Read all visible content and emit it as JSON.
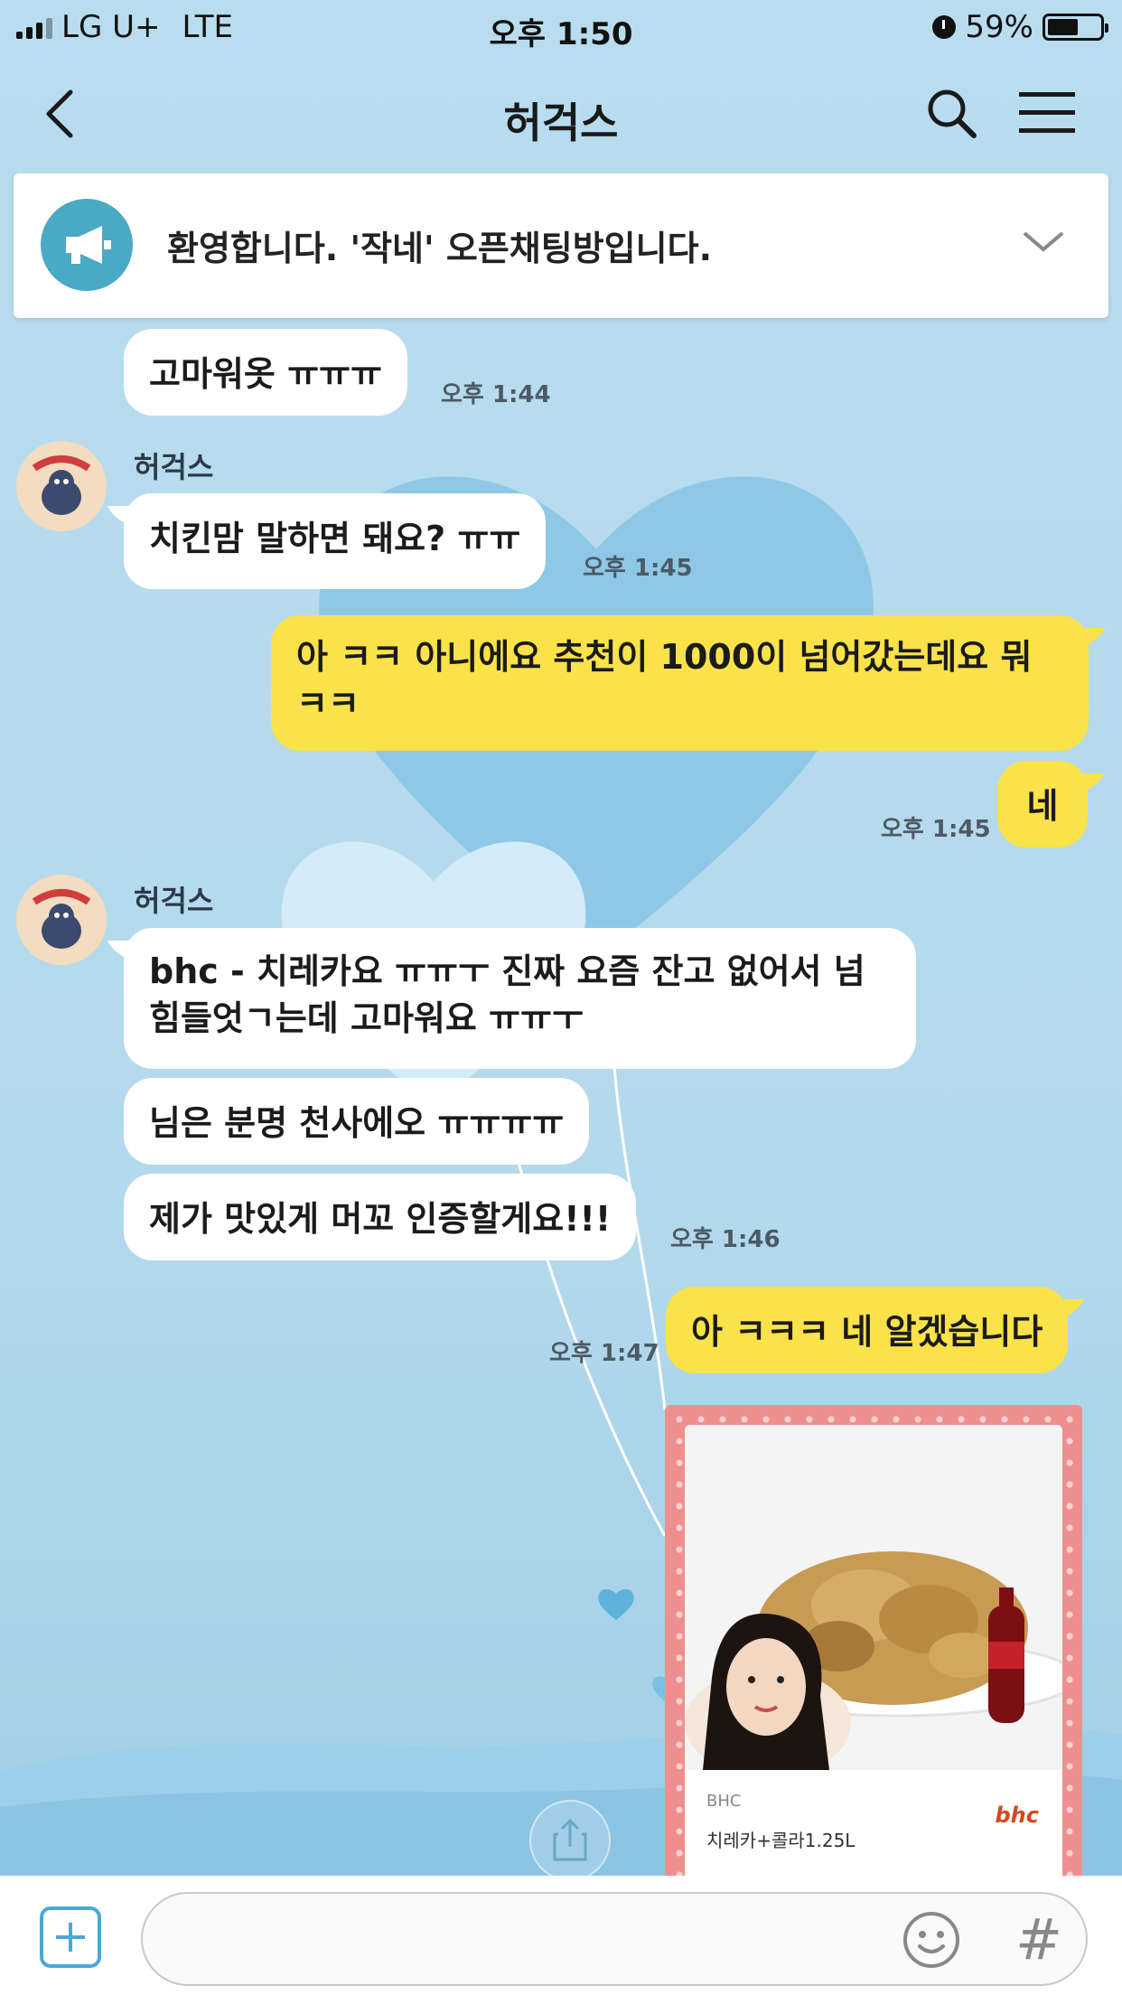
{
  "status_bar": {
    "carrier": "LG U+",
    "network": "LTE",
    "time": "오후 1:50",
    "battery": "59%",
    "battery_level": 0.59
  },
  "header": {
    "title": "허걱스"
  },
  "notice": {
    "text": "환영합니다. '작네' 오픈채팅방입니다."
  },
  "messages": [
    {
      "id": "m1",
      "direction": "in",
      "text": "고마워옷 ㅠㅠㅠ",
      "time": "오후 1:44"
    },
    {
      "id": "m2",
      "direction": "in",
      "sender": "허걱스",
      "text": "치킨맘 말하면 돼요? ㅠㅠ",
      "time": "오후 1:45"
    },
    {
      "id": "m3",
      "direction": "out",
      "text_line1": "아 ㅋㅋ 아니에요 추천이 1000이 넘어갔는데요 뭐",
      "text_line2": "ㅋㅋ"
    },
    {
      "id": "m4",
      "direction": "out",
      "text": "네",
      "time": "오후 1:45"
    },
    {
      "id": "m5",
      "direction": "in",
      "sender": "허걱스",
      "text_line1": "bhc - 치레카요 ㅠㅠㅜ 진짜 요즘 잔고 없어서 넘",
      "text_line2": "힘들엇ㄱ는데 고마워요 ㅠㅠㅜ"
    },
    {
      "id": "m6",
      "direction": "in",
      "text": "님은 분명 천사에오 ㅠㅠㅠㅠ"
    },
    {
      "id": "m7",
      "direction": "in",
      "text": "제가 맛있게 머꼬 인증할게요!!!",
      "time": "오후 1:46"
    },
    {
      "id": "m8",
      "direction": "out",
      "text": "아 ㅋㅋㅋ 네 알겠습니다",
      "time": "오후 1:47"
    }
  ],
  "product_card": {
    "brand": "BHC",
    "name": "치레카+콜라1.25L",
    "logo": "bhc"
  },
  "input_bar": {
    "placeholder": ""
  },
  "colors": {
    "background": "#b7dcee",
    "outgoing_bubble": "#f9e24a",
    "incoming_bubble": "#ffffff",
    "accent": "#4aa9c4"
  }
}
